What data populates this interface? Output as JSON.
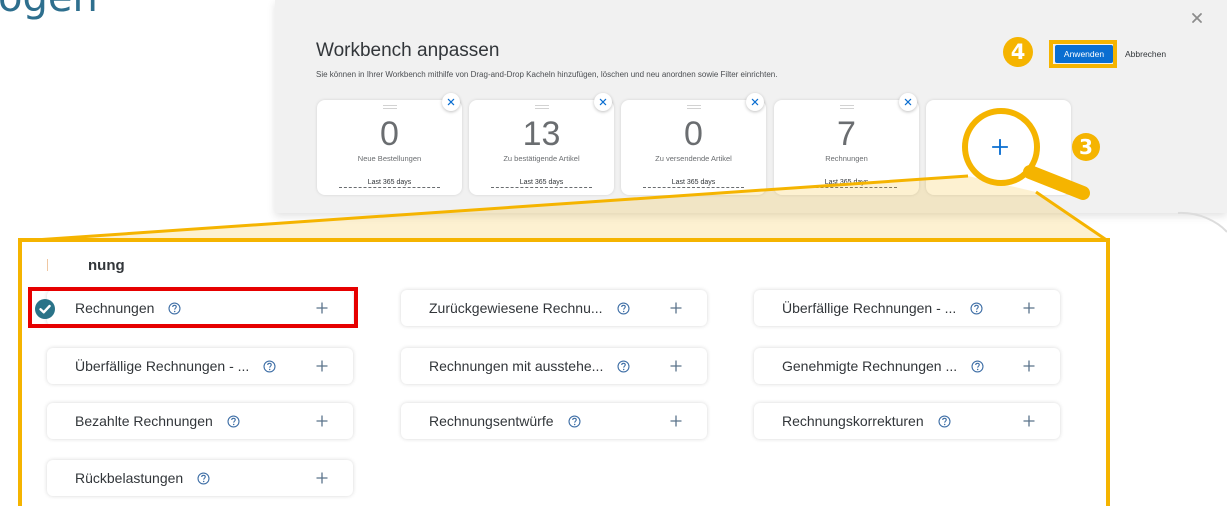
{
  "page": {
    "partial_heading": "ogen"
  },
  "dialog": {
    "title": "Workbench anpassen",
    "description": "Sie können in Ihrer Workbench mithilfe von Drag-and-Drop Kacheln hinzufügen, löschen und neu anordnen sowie Filter einrichten.",
    "apply_label": "Anwenden",
    "cancel_label": "Abbrechen",
    "close_icon": "close-icon",
    "tiles": [
      {
        "value": "0",
        "label": "Neue Bestellungen",
        "period": "Last 365 days",
        "remove_icon": "close-icon"
      },
      {
        "value": "13",
        "label": "Zu bestätigende Artikel",
        "period": "Last 365 days",
        "remove_icon": "close-icon"
      },
      {
        "value": "0",
        "label": "Zu versendende Artikel",
        "period": "Last 365 days",
        "remove_icon": "close-icon"
      },
      {
        "value": "7",
        "label": "Rechnungen",
        "period": "Last 365 days",
        "remove_icon": "close-icon"
      }
    ],
    "add_tile_icon": "plus-icon"
  },
  "callouts": {
    "step_3": "3",
    "step_4": "4",
    "magnifier_icon": "magnifier-icon"
  },
  "tile_picker": {
    "heading": "nung",
    "info_icon": "question-circle-icon",
    "add_icon": "plus-icon",
    "selected_icon": "check-circle-icon",
    "items": [
      {
        "label": "Rechnungen",
        "selected": true
      },
      {
        "label": "Zurückgewiesene Rechnu...",
        "selected": false
      },
      {
        "label": "Überfällige Rechnungen - ...",
        "selected": false
      },
      {
        "label": "Überfällige Rechnungen - ...",
        "selected": false
      },
      {
        "label": "Rechnungen mit ausstehe...",
        "selected": false
      },
      {
        "label": "Genehmigte Rechnungen ...",
        "selected": false
      },
      {
        "label": "Bezahlte Rechnungen",
        "selected": false
      },
      {
        "label": "Rechnungsentwürfe",
        "selected": false
      },
      {
        "label": "Rechnungskorrekturen",
        "selected": false
      },
      {
        "label": "Rückbelastungen",
        "selected": false
      }
    ]
  },
  "colors": {
    "accent_gold": "#f5b400",
    "highlight_red": "#e60000",
    "primary_blue": "#0a6ed1",
    "check_teal": "#2a7388",
    "heading_teal": "#2e6f8e",
    "dialog_background": "#f1f1f1"
  }
}
